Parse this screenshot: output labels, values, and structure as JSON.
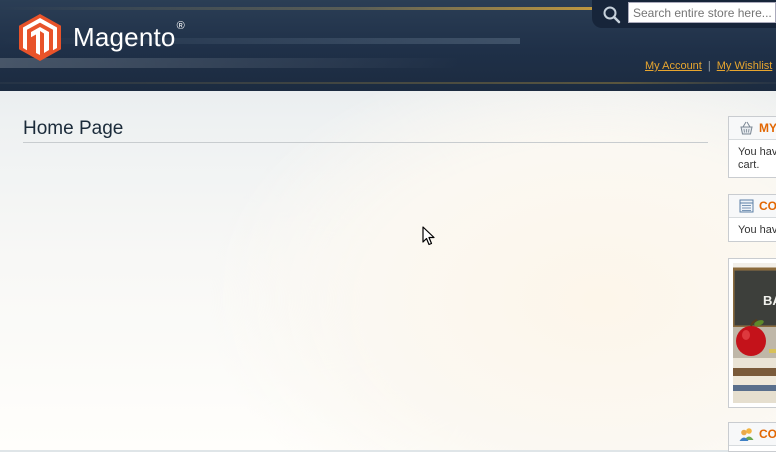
{
  "header": {
    "logo_text": "Magento",
    "logo_reg": "®",
    "search": {
      "placeholder": "Search entire store here..."
    },
    "links": {
      "account": "My Account",
      "separator": "|",
      "wishlist": "My Wishlist"
    }
  },
  "main": {
    "page_title": "Home Page"
  },
  "sidebar": {
    "cart": {
      "title": "MY",
      "content_line1": "You hav",
      "content_line2": "cart."
    },
    "compare": {
      "title": "CO",
      "content": "You hav"
    },
    "banner": {
      "text": "BA"
    },
    "community": {
      "title": "CO"
    }
  },
  "colors": {
    "header_bg": "#1f3048",
    "accent_orange": "#e26703",
    "link_gold": "#e8a62f"
  }
}
